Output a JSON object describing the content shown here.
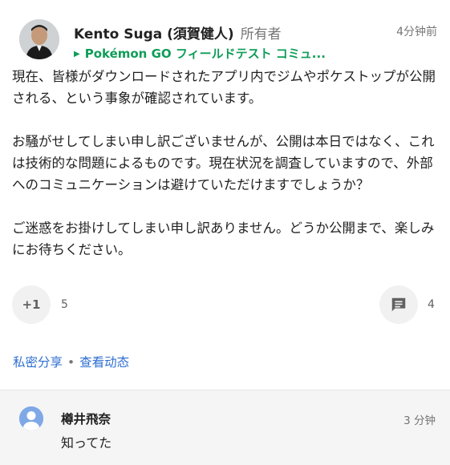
{
  "post": {
    "author_name": "Kento Suga (須賀健人)",
    "owner_label": "所有者",
    "timestamp": "4分钟前",
    "community": "Pokémon GO フィールドテスト コミュ...",
    "body": [
      "現在、皆様がダウンロードされたアプリ内でジムやポケストップが公開される、という事象が確認されています。",
      "お騒がせしてしまい申し訳ございませんが、公開は本日ではなく、これは技術的な問題によるものです。現在状況を調査していますので、外部へのコミュニケーションは避けていただけますでしょうか？",
      "ご迷惑をお掛けしてしまい申し訳ありません。どうか公開まで、楽しみにお待ちください。"
    ],
    "plus_one_label": "+1",
    "plus_one_count": "5",
    "comment_count": "4",
    "share_links": {
      "private_share": "私密分享",
      "separator": "•",
      "view_activity": "查看动态"
    }
  },
  "comment": {
    "author": "樽井飛奈",
    "time": "3 分钟",
    "text": "知ってた"
  },
  "icons": {
    "author_avatar": "person-photo",
    "commenter_avatar": "default-person-icon",
    "comment_button": "comment-icon",
    "community_arrow": "triangle-right-icon"
  }
}
